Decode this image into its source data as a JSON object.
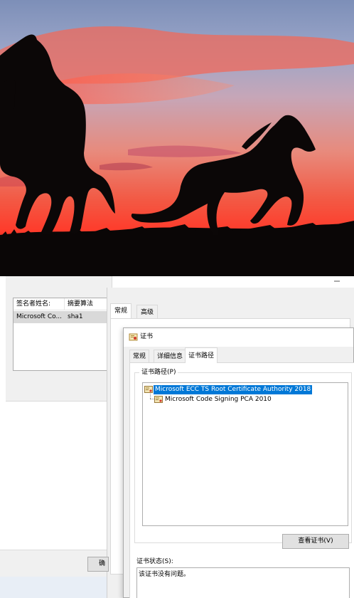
{
  "signature_list": {
    "headers": [
      "签名者姓名:",
      "摘要算法"
    ],
    "rows": [
      {
        "signer": "Microsoft Co...",
        "digest": "sha1"
      }
    ]
  },
  "properties_window": {
    "tabs": [
      "常规",
      "高级"
    ],
    "partial_button_label": "确"
  },
  "certificate_dialog": {
    "title": "证书",
    "tabs": [
      "常规",
      "详细信息",
      "证书路径"
    ],
    "active_tab": "证书路径",
    "path_group_label": "证书路径(P)",
    "path_items": [
      {
        "label": "Microsoft ECC TS Root Certificate Authority 2018",
        "selected": true,
        "icon": "certificate-icon"
      },
      {
        "label": "Microsoft Code Signing PCA 2010",
        "selected": false,
        "icon": "certificate-icon"
      }
    ],
    "view_certificate_button": "查看证书(V)",
    "status_label": "证书状态(S):",
    "status_text": "该证书没有问题。"
  },
  "colors": {
    "selection": "#0078d7",
    "dialog_bg": "#f0f0f0",
    "sky_top": "#8aa0c8",
    "sky_glow": "#ff6a4d"
  }
}
